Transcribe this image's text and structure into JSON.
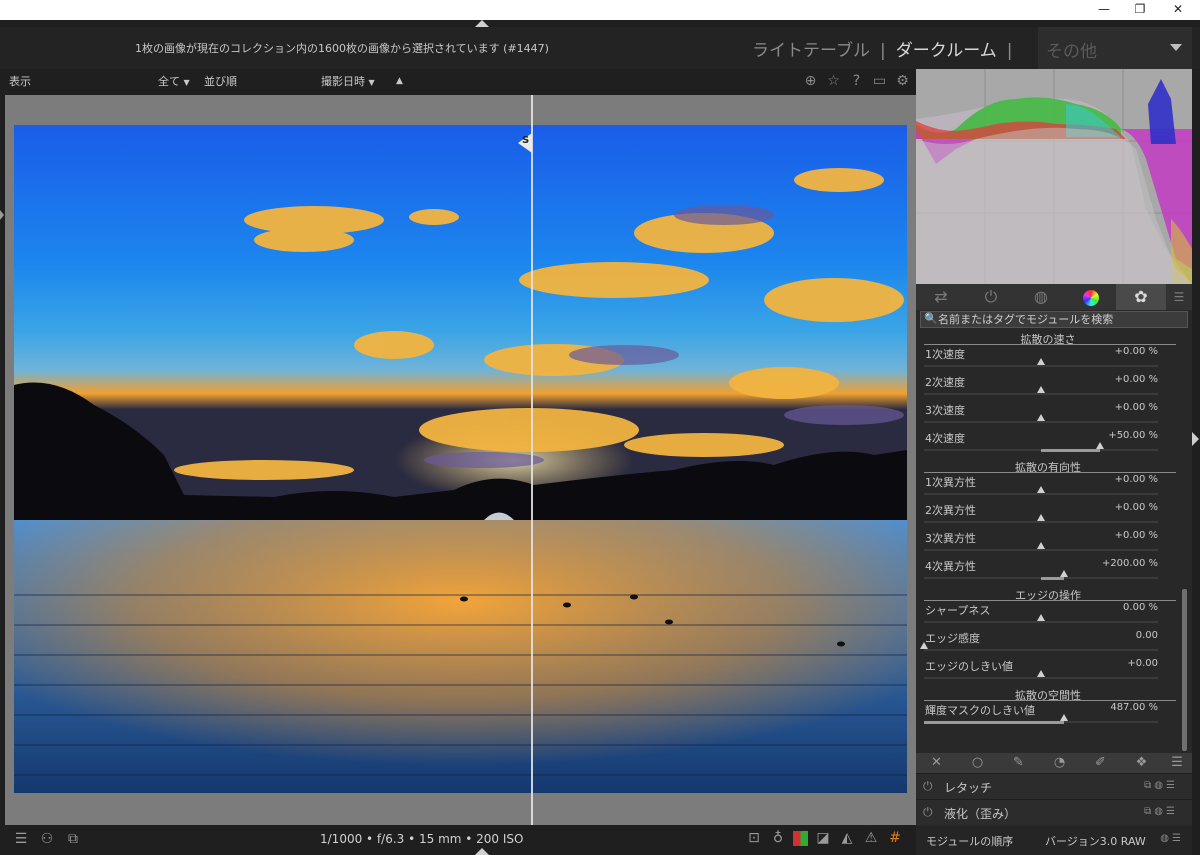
{
  "window": {
    "minimize": "—",
    "restore": "❐",
    "close": "✕"
  },
  "header": {
    "selection_info": "1枚の画像が現在のコレクション内の1600枚の画像から選択されています (#1447)",
    "views": {
      "lighttable": "ライトテーブル",
      "darkroom": "ダークルーム",
      "separator": "|",
      "other": "その他"
    }
  },
  "filterbar": {
    "display": "表示",
    "all": "全て",
    "sort": "並び順",
    "sort_field": "撮影日時"
  },
  "split": {
    "marker": "S"
  },
  "bottom": {
    "exif": "1/1000 • f/6.3 • 15 mm • 200 ISO"
  },
  "panel": {
    "search_placeholder": "名前またはタグでモジュールを検索",
    "sections": [
      {
        "title": "拡散の速さ",
        "rows": [
          {
            "label": "1次速度",
            "value": "+0.00 %",
            "level": 0.5,
            "fill_from": null
          },
          {
            "label": "2次速度",
            "value": "+0.00 %",
            "level": 0.5,
            "fill_from": null
          },
          {
            "label": "3次速度",
            "value": "+0.00 %",
            "level": 0.5,
            "fill_from": null
          },
          {
            "label": "4次速度",
            "value": "+50.00 %",
            "level": 0.75,
            "fill_from": 0.5
          }
        ]
      },
      {
        "title": "拡散の有向性",
        "rows": [
          {
            "label": "1次異方性",
            "value": "+0.00 %",
            "level": 0.5,
            "fill_from": null
          },
          {
            "label": "2次異方性",
            "value": "+0.00 %",
            "level": 0.5,
            "fill_from": null
          },
          {
            "label": "3次異方性",
            "value": "+0.00 %",
            "level": 0.5,
            "fill_from": null
          },
          {
            "label": "4次異方性",
            "value": "+200.00 %",
            "level": 0.6,
            "fill_from": 0.5
          }
        ]
      },
      {
        "title": "エッジの操作",
        "rows": [
          {
            "label": "シャープネス",
            "value": "0.00 %",
            "level": 0.5,
            "fill_from": null
          },
          {
            "label": "エッジ感度",
            "value": "0.00",
            "level": 0.0,
            "fill_from": null
          },
          {
            "label": "エッジのしきい値",
            "value": "+0.00",
            "level": 0.5,
            "fill_from": null
          }
        ]
      },
      {
        "title": "拡散の空間性",
        "rows": [
          {
            "label": "輝度マスクのしきい値",
            "value": "487.00 %",
            "level": 0.6,
            "fill_from": 0.0
          }
        ]
      }
    ],
    "modules": [
      {
        "name": "レタッチ"
      },
      {
        "name": "液化（歪み）"
      }
    ],
    "footer": {
      "order_label": "モジュールの順序",
      "version": "バージョン3.0 RAW"
    }
  },
  "colors": {
    "accent_red": "#e03c3c",
    "accent_green": "#3cc43c",
    "accent_blue": "#3c5ce0",
    "active_tab": "#4a4a4a"
  },
  "icons": {
    "filterbar": [
      "grid-icon",
      "star-icon",
      "help-icon",
      "keyboard-icon",
      "gear-icon"
    ],
    "tabs": [
      "quick-access-icon",
      "active-modules-icon",
      "base-icon",
      "color-icon",
      "effects-icon"
    ],
    "masks": [
      "no-mask-icon",
      "uniform-mask-icon",
      "drawn-mask-icon",
      "parametric-mask-icon",
      "drawn-parametric-mask-icon",
      "raster-mask-icon"
    ],
    "bottom_left": [
      "filmstrip-icon",
      "timeline-icon",
      "display-icon"
    ],
    "bottom_right": [
      "focus-peaking-icon",
      "bulb-icon",
      "color-assessment-icon",
      "softproof-icon",
      "gamut-check-icon",
      "warning-icon",
      "guides-icon"
    ]
  }
}
